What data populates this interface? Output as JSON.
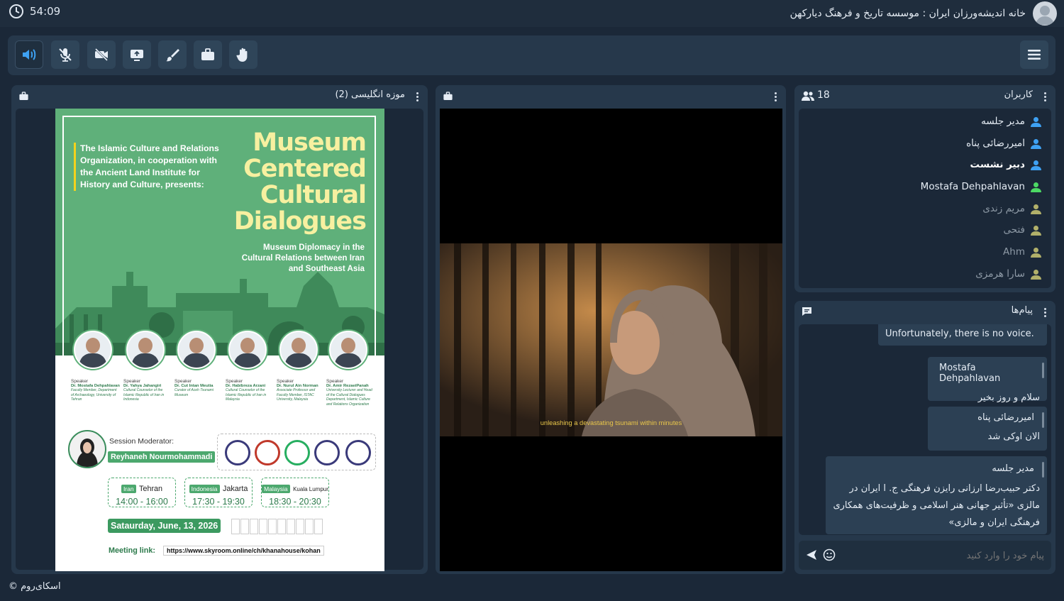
{
  "header": {
    "timer": "54:09",
    "room_title": "خانه اندیشه‌ورزان ایران : موسسه تاریخ و فرهنگ دیارکهن"
  },
  "toolbar": {
    "buttons": [
      "speaker-icon",
      "mic-off-icon",
      "camera-off-icon",
      "screen-share-icon",
      "brush-icon",
      "briefcase-icon",
      "raise-hand-icon"
    ],
    "menu": "hamburger-icon"
  },
  "content_panel": {
    "title": "موزه انگلیسی (2)"
  },
  "poster": {
    "org_text": "The Islamic Culture and Relations Organization, in cooperation with the Ancient Land Institute for History and Culture, presents:",
    "title_lines": [
      "Museum",
      "Centered",
      "Cultural",
      "Dialogues"
    ],
    "subtitle": "Museum Diplomacy in the Cultural Relations between Iran and Southeast Asia",
    "speakers": [
      {
        "label": "Speaker",
        "name": "Dr. Mostafa Dehpahlavan",
        "role": "Faculty Member, Department of Archaeology, University of Tehran"
      },
      {
        "label": "Speaker",
        "name": "Dr. Yahya Jahangiri",
        "role": "Cultural Counselor of the Islamic Republic of Iran in Indonesia"
      },
      {
        "label": "Speaker",
        "name": "Dr. Cut Intan Meutia",
        "role": "Curator of Aceh Tsunami Museum"
      },
      {
        "label": "Speaker",
        "name": "Dr. Habibreza Arzani",
        "role": "Cultural Counselor of the Islamic Republic of Iran in Malaysia"
      },
      {
        "label": "Speaker",
        "name": "Dr. Nurul Ain Norman",
        "role": "Associate Professor and Faculty Member, ISTAC University, Malaysia"
      },
      {
        "label": "Speaker",
        "name": "Dr. Amir RezaeiPanah",
        "role": "University Lecturer and Head of the Cultural Dialogues Department, Islamic Culture and Relations Organization"
      }
    ],
    "moderator_label": "Session Moderator:",
    "moderator_name": "Reyhaneh Nourmohammadi",
    "timezones": [
      {
        "country": "Iran",
        "city": "Tehran",
        "time": "14:00 - 16:00"
      },
      {
        "country": "Indonesia",
        "city": "Jakarta",
        "time": "17:30 - 19:30"
      },
      {
        "country": "Malaysia",
        "city": "Kuala Lumpur",
        "time": "18:30 - 20:30"
      }
    ],
    "date": "Sataurday, June, 13, 2026",
    "meeting_link_label": "Meeting link:",
    "meeting_link": "https://www.skyroom.online/ch/khanahouse/kohan"
  },
  "video": {
    "caption": "unleashing a devastating tsunami within minutes"
  },
  "users_panel": {
    "title": "کاربران",
    "count": "18",
    "users": [
      {
        "name": "مدیر جلسه",
        "color": "#3ea1f3"
      },
      {
        "name": "امیررضائی پناه",
        "color": "#3ea1f3"
      },
      {
        "name": "دبیر نشست",
        "color": "#3ea1f3"
      },
      {
        "name": "Mostafa Dehpahlavan",
        "color": "#4cd964"
      },
      {
        "name": "مریم زندی",
        "color": "#b1b06a"
      },
      {
        "name": "فتحی",
        "color": "#b1b06a"
      },
      {
        "name": "Ahm",
        "color": "#b1b06a"
      },
      {
        "name": "سارا هرمزی",
        "color": "#b1b06a"
      }
    ]
  },
  "messages_panel": {
    "title": "پیام‌ها",
    "messages": [
      {
        "sender": "",
        "text": "Unfortunately, there is no voice."
      },
      {
        "sender": "Mostafa Dehpahlavan",
        "text": "سلام و روز بخیر"
      },
      {
        "sender": "امیررضائی پناه",
        "text": "الان اوکی شد"
      },
      {
        "sender": "مدیر جلسه",
        "text": "دکتر حبیب‌رضا ارزانی رایزن فرهنگی ج. ا ایران در مالزی «تأثیر جهانی هنر اسلامی و ظرفیت‌های همکاری فرهنگی ایران و مالزی»"
      }
    ],
    "input_placeholder": "پیام خود را وارد کنید"
  },
  "footer": {
    "text": "اسکای‌روم ©"
  }
}
